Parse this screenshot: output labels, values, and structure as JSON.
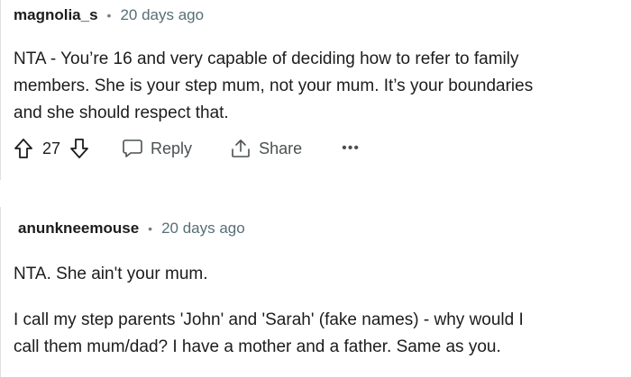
{
  "comments": [
    {
      "username": "magnolia_s",
      "separator": "•",
      "time": "20 days ago",
      "body": [
        "NTA - You’re 16 and very capable of deciding how to refer to family",
        "members. She is your step mum, not your mum. It’s your boundaries",
        "and she should respect that."
      ],
      "score": "27",
      "actions": {
        "reply_label": "Reply",
        "share_label": "Share",
        "more_label": "•••"
      }
    },
    {
      "username": "anunkneemouse",
      "separator": "•",
      "time": "20 days ago",
      "body": [
        "NTA. She ain't your mum.",
        "I call my step parents 'John' and 'Sarah' (fake names) - why would I",
        "call them mum/dad? I have a mother and a father. Same as you."
      ]
    }
  ],
  "icons": {
    "upvote": "arrow-up-icon",
    "downvote": "arrow-down-icon",
    "reply": "speech-bubble-icon",
    "share": "share-icon",
    "more": "ellipsis-icon"
  }
}
